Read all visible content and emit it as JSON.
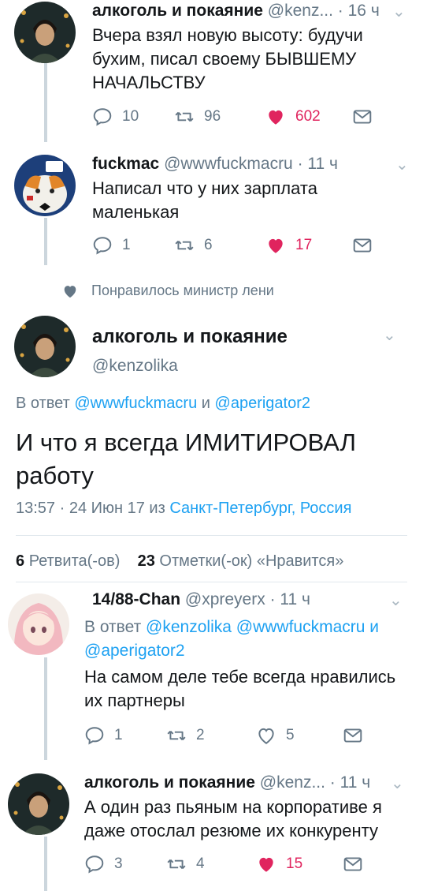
{
  "tweets": [
    {
      "name": "алкоголь и покаяние",
      "handle": "@kenz...",
      "time": "· 16 ч",
      "text": "Вчера взял новую высоту: будучи бухим, писал своему БЫВШЕМУ НАЧАЛЬСТВУ",
      "replies": "10",
      "retweets": "96",
      "likes": "602",
      "liked": true
    },
    {
      "name": "fuckmac",
      "handle": "@wwwfuckmacru",
      "time": "· 11 ч",
      "text": "Написал что у них зарплата маленькая",
      "replies": "1",
      "retweets": "6",
      "likes": "17",
      "liked": true
    }
  ],
  "liked_by": "Понравилось министр лени",
  "main": {
    "name": "алкоголь и покаяние",
    "handle": "@kenzolika",
    "reply_prefix": "В ответ",
    "reply_m1": "@wwwfuckmacru",
    "reply_and": "и",
    "reply_m2": "@aperigator2",
    "text": "И что я всегда ИМИТИРОВАЛ работу",
    "meta_time": "13:57 · 24 Июн 17 из",
    "meta_location": "Санкт-Петербург, Россия",
    "retweets_count": "6",
    "retweets_label": "Ретвита(-ов)",
    "likes_count": "23",
    "likes_label": "Отметки(-ок) «Нравится»"
  },
  "replies": [
    {
      "name": "14/88-Chan",
      "handle": "@xpreyerx",
      "time": "· 11 ч",
      "reply_prefix": "В ответ",
      "reply_m1": "@kenzolika",
      "reply_m2": "@wwwfuckmacru",
      "reply_and": "и",
      "reply_m3": "@aperigator2",
      "text": "На самом деле тебе всегда нравились их партнеры",
      "replies": "1",
      "retweets": "2",
      "likes": "5",
      "liked": false
    },
    {
      "name": "алкоголь и покаяние",
      "handle": "@kenz...",
      "time": "· 11 ч",
      "text": "А один раз пьяным на корпоративе я даже отослал резюме их конкуренту",
      "replies": "3",
      "retweets": "4",
      "likes": "15",
      "liked": true
    }
  ],
  "colors": {
    "accent": "#1da1f2",
    "like": "#e0245e",
    "muted": "#657786",
    "text": "#14171a"
  }
}
